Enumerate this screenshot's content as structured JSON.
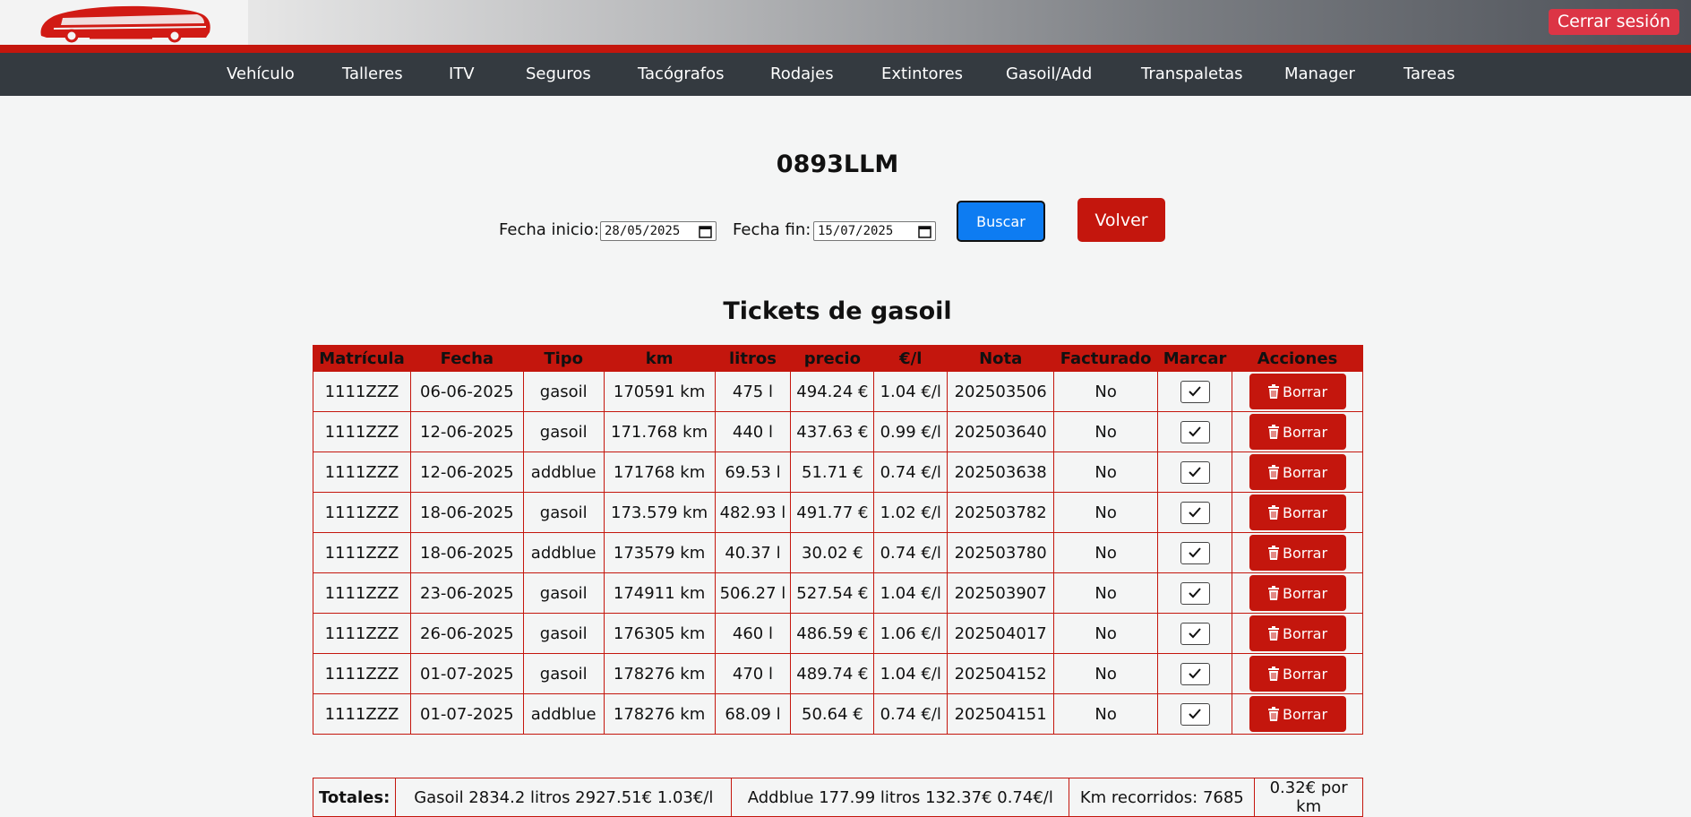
{
  "header": {
    "logout_label": "Cerrar sesión",
    "brand_color": "#c4160d"
  },
  "nav": [
    {
      "label": "Vehículo"
    },
    {
      "label": "Talleres"
    },
    {
      "label": "ITV"
    },
    {
      "label": "Seguros"
    },
    {
      "label": "Tacógrafos"
    },
    {
      "label": "Rodajes"
    },
    {
      "label": "Extintores"
    },
    {
      "label": "Gasoil/Add"
    },
    {
      "label": "Transpaletas"
    },
    {
      "label": "Manager"
    },
    {
      "label": "Tareas"
    }
  ],
  "page": {
    "plate": "0893LLM",
    "section_title": "Tickets de gasoil"
  },
  "filters": {
    "start_label": "Fecha inicio:",
    "start_value": "28/05/2025",
    "end_label": "Fecha fin:",
    "end_value": "15/07/2025",
    "search_label": "Buscar",
    "back_label": "Volver"
  },
  "table": {
    "headers": [
      "Matrícula",
      "Fecha",
      "Tipo",
      "km",
      "litros",
      "precio",
      "€/l",
      "Nota",
      "Facturado",
      "Marcar",
      "Acciones"
    ],
    "delete_label": "Borrar",
    "rows": [
      {
        "plate": "1111ZZZ",
        "date": "06-06-2025",
        "type": "gasoil",
        "km": "170591 km",
        "liters": "475 l",
        "price": "494.24 €",
        "ppl": "1.04 €/l",
        "note": "202503506",
        "billed": "No"
      },
      {
        "plate": "1111ZZZ",
        "date": "12-06-2025",
        "type": "gasoil",
        "km": "171.768 km",
        "liters": "440 l",
        "price": "437.63 €",
        "ppl": "0.99 €/l",
        "note": "202503640",
        "billed": "No"
      },
      {
        "plate": "1111ZZZ",
        "date": "12-06-2025",
        "type": "addblue",
        "km": "171768 km",
        "liters": "69.53 l",
        "price": "51.71 €",
        "ppl": "0.74 €/l",
        "note": "202503638",
        "billed": "No"
      },
      {
        "plate": "1111ZZZ",
        "date": "18-06-2025",
        "type": "gasoil",
        "km": "173.579 km",
        "liters": "482.93 l",
        "price": "491.77 €",
        "ppl": "1.02 €/l",
        "note": "202503782",
        "billed": "No"
      },
      {
        "plate": "1111ZZZ",
        "date": "18-06-2025",
        "type": "addblue",
        "km": "173579 km",
        "liters": "40.37 l",
        "price": "30.02 €",
        "ppl": "0.74 €/l",
        "note": "202503780",
        "billed": "No"
      },
      {
        "plate": "1111ZZZ",
        "date": "23-06-2025",
        "type": "gasoil",
        "km": "174911 km",
        "liters": "506.27 l",
        "price": "527.54 €",
        "ppl": "1.04 €/l",
        "note": "202503907",
        "billed": "No"
      },
      {
        "plate": "1111ZZZ",
        "date": "26-06-2025",
        "type": "gasoil",
        "km": "176305 km",
        "liters": "460 l",
        "price": "486.59 €",
        "ppl": "1.06 €/l",
        "note": "202504017",
        "billed": "No"
      },
      {
        "plate": "1111ZZZ",
        "date": "01-07-2025",
        "type": "gasoil",
        "km": "178276 km",
        "liters": "470 l",
        "price": "489.74 €",
        "ppl": "1.04 €/l",
        "note": "202504152",
        "billed": "No"
      },
      {
        "plate": "1111ZZZ",
        "date": "01-07-2025",
        "type": "addblue",
        "km": "178276 km",
        "liters": "68.09 l",
        "price": "50.64 €",
        "ppl": "0.74 €/l",
        "note": "202504151",
        "billed": "No"
      }
    ]
  },
  "totals": {
    "label": "Totales:",
    "gasoil": "Gasoil 2834.2 litros 2927.51€ 1.03€/l",
    "addblue": "Addblue 177.99 litros 132.37€ 0.74€/l",
    "km": "Km recorridos: 7685",
    "per_km": "0.32€ por km"
  }
}
